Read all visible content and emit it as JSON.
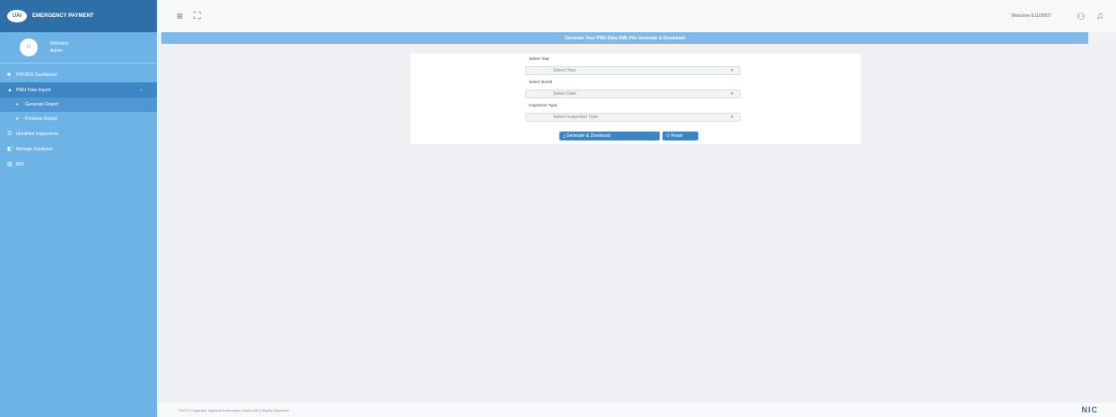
{
  "brand": {
    "logo": "UAI",
    "title": "EMERGENCY PAYMENT"
  },
  "user": {
    "avatar": "U",
    "name": "Welcome",
    "role": "Admin"
  },
  "sidebar": {
    "items": [
      {
        "label": "PAY/ROI Dashboard",
        "icon": "dashboard-icon"
      },
      {
        "label": "PMU Data Import",
        "icon": "upload-icon",
        "expanded": true
      },
      {
        "label": "Generate Report",
        "sub": true,
        "active": true
      },
      {
        "label": "Previous Report",
        "sub": true
      },
      {
        "label": "Identified Inspections",
        "icon": "list-icon"
      },
      {
        "label": "Manage Database",
        "icon": "database-icon"
      },
      {
        "label": "MIS",
        "icon": "chart-icon"
      }
    ]
  },
  "topbar": {
    "welcome": "Welcome EJ100007"
  },
  "page": {
    "title": "Generate Your PMU Data XML File Generate & Download"
  },
  "form": {
    "year_label": "Select Year",
    "year_value": "Select Year",
    "month_label": "Select Month",
    "month_value": "Select Date",
    "type_label": "Inspection Type",
    "type_value": "Select Inspection Type",
    "generate_label": "Generate & Download",
    "reset_label": "Reset"
  },
  "footer": {
    "text": "2023 © Copyright. National Informatics Centre (NIC) Rights Reserved",
    "logo": "NIC"
  },
  "colors": {
    "sidebar": "#6eb3e6",
    "brand": "#2f6fa8",
    "accent": "#3d86c4",
    "title_bar": "#7fb9e6"
  }
}
